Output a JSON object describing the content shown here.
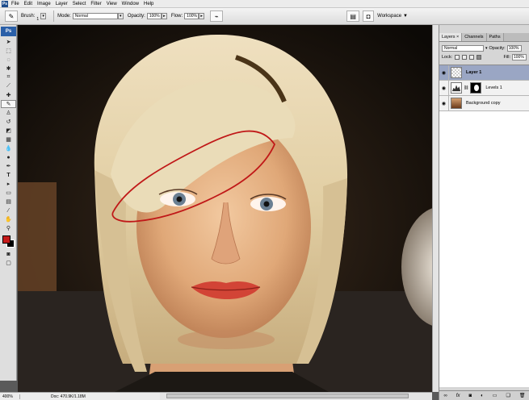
{
  "menubar": {
    "items": [
      "File",
      "Edit",
      "Image",
      "Layer",
      "Select",
      "Filter",
      "View",
      "Window",
      "Help"
    ]
  },
  "options": {
    "brush_label": "Brush:",
    "brush_size": "1",
    "mode_label": "Mode:",
    "mode_value": "Normal",
    "opacity_label": "Opacity:",
    "opacity_value": "100%",
    "flow_label": "Flow:",
    "flow_value": "100%",
    "workspace_label": "Workspace"
  },
  "colors": {
    "foreground": "#c51a1a",
    "background": "#000000",
    "path_stroke": "#c01818"
  },
  "panel": {
    "tabs": [
      "Layers ×",
      "Channels",
      "Paths"
    ],
    "blend_mode": "Normal",
    "opacity_label": "Opacity:",
    "opacity_value": "100%",
    "lock_label": "Lock:",
    "fill_label": "Fill:",
    "fill_value": "100%",
    "layers": [
      {
        "name": "Layer 1",
        "selected": true
      },
      {
        "name": "Levels 1",
        "selected": false
      },
      {
        "name": "Background copy",
        "selected": false
      }
    ],
    "footer_icons": [
      "link-icon",
      "fx-icon",
      "mask-icon",
      "adjustment-icon",
      "folder-icon",
      "new-layer-icon",
      "trash-icon"
    ]
  },
  "status": {
    "zoom": "400%",
    "doc": "Doc: 470.9K/1.18M"
  }
}
